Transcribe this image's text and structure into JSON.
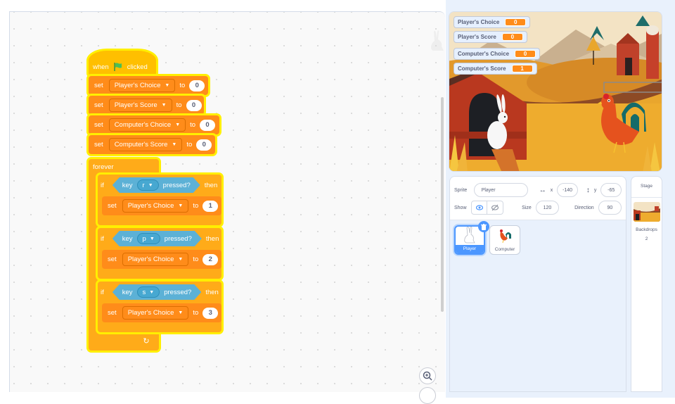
{
  "code_area": {
    "script": {
      "hat": {
        "when": "when",
        "clicked": "clicked",
        "icon": "green-flag"
      },
      "init_sets": [
        {
          "set": "set",
          "var": "Player's Choice",
          "to": "to",
          "value": "0"
        },
        {
          "set": "set",
          "var": "Player's Score",
          "to": "to",
          "value": "0"
        },
        {
          "set": "set",
          "var": "Computer's Choice",
          "to": "to",
          "value": "0"
        },
        {
          "set": "set",
          "var": "Computer's Score",
          "to": "to",
          "value": "0"
        }
      ],
      "forever": "forever",
      "ifs": [
        {
          "if": "if",
          "key": "key",
          "key_value": "r",
          "pressed": "pressed?",
          "then": "then",
          "set": "set",
          "var": "Player's Choice",
          "to": "to",
          "value": "1"
        },
        {
          "if": "if",
          "key": "key",
          "key_value": "p",
          "pressed": "pressed?",
          "then": "then",
          "set": "set",
          "var": "Player's Choice",
          "to": "to",
          "value": "2"
        },
        {
          "if": "if",
          "key": "key",
          "key_value": "s",
          "pressed": "pressed?",
          "then": "then",
          "set": "set",
          "var": "Player's Choice",
          "to": "to",
          "value": "3"
        }
      ],
      "loop_arrow": "↻"
    },
    "zoom_in_icon": "⊕"
  },
  "stage": {
    "monitors": [
      {
        "label": "Player's Choice",
        "value": "0"
      },
      {
        "label": "Player's Score",
        "value": "0"
      },
      {
        "label": "Computer's Choice",
        "value": "0"
      },
      {
        "label": "Computer's Score",
        "value": "1"
      }
    ]
  },
  "sprite_info": {
    "sprite_label": "Sprite",
    "sprite_name": "Player",
    "x_label": "x",
    "x_value": "-140",
    "y_label": "y",
    "y_value": "-65",
    "show_label": "Show",
    "size_label": "Size",
    "size_value": "120",
    "direction_label": "Direction",
    "direction_value": "90"
  },
  "sprites": [
    {
      "name": "Player",
      "selected": true
    },
    {
      "name": "Computer",
      "selected": false
    }
  ],
  "stage_pane": {
    "title": "Stage",
    "backdrops_label": "Backdrops",
    "backdrops_count": "2"
  },
  "colors": {
    "motion_blue": "#4c97ff",
    "variables_orange": "#ff8c1a",
    "control_yellow": "#ffab19",
    "events_yellow": "#ffbf00",
    "sensing_blue": "#5cb1d6",
    "glow": "#ffef00"
  }
}
